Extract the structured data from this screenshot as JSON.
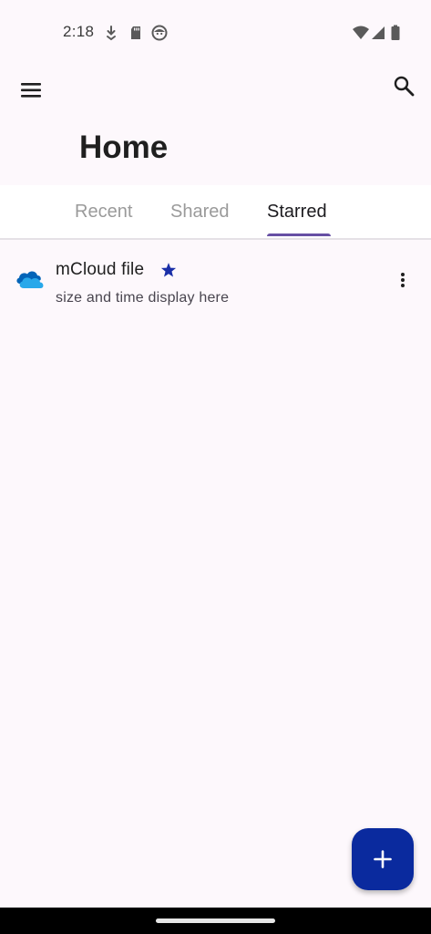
{
  "status_bar": {
    "time": "2:18",
    "left_icons": [
      "download-icon",
      "sd-card-icon",
      "face-icon"
    ],
    "right_icons": [
      "wifi-icon",
      "signal-icon",
      "battery-icon"
    ]
  },
  "toolbar": {
    "menu_icon": "menu-icon",
    "search_icon": "search-icon"
  },
  "page": {
    "title": "Home"
  },
  "tabs": [
    {
      "label": "Recent",
      "active": false
    },
    {
      "label": "Shared",
      "active": false
    },
    {
      "label": "Starred",
      "active": true
    }
  ],
  "files": [
    {
      "name": "mCloud file",
      "meta": "size and time display here",
      "icon": "cloud-icon",
      "starred": true
    }
  ],
  "fab": {
    "icon": "plus-icon"
  },
  "colors": {
    "background": "#fdf8fc",
    "accent": "#6750a4",
    "fab": "#0a2a9e",
    "star": "#1a2fa8",
    "cloud_dark": "#0364b8",
    "cloud_light": "#28a8ea"
  }
}
